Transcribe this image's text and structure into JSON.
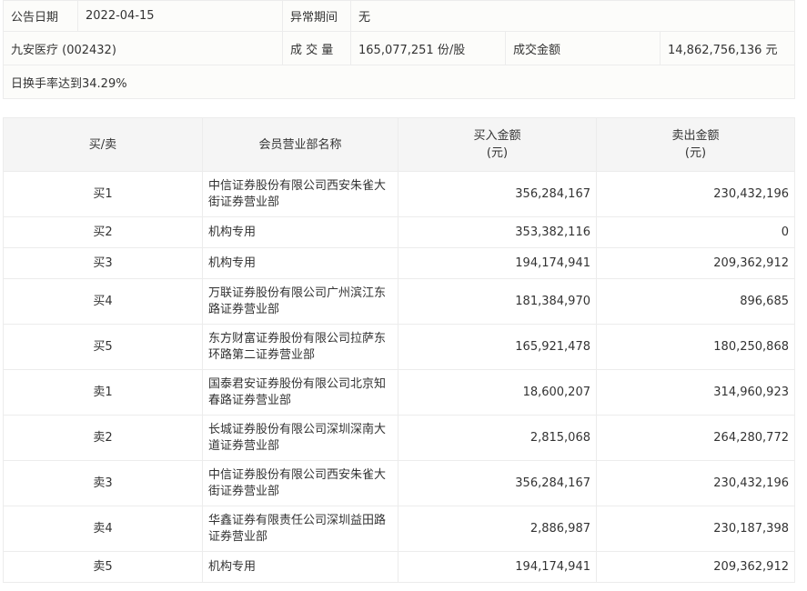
{
  "info": {
    "date_label": "公告日期",
    "date": "2022-04-15",
    "period_label": "异常期间",
    "period": "无",
    "stock": "九安医疗 (002432)",
    "volume_label": "成 交 量",
    "volume": "165,077,251 份/股",
    "amount_label": "成交金额",
    "amount": "14,862,756,136 元",
    "reason": "日换手率达到34.29%"
  },
  "table": {
    "headers": [
      "买/卖",
      "会员营业部名称",
      "买入金额\n(元)",
      "卖出金额\n(元)"
    ],
    "rows": [
      {
        "side": "买1",
        "name": "中信证券股份有限公司西安朱雀大街证券营业部",
        "buy": "356,284,167",
        "sell": "230,432,196"
      },
      {
        "side": "买2",
        "name": "机构专用",
        "buy": "353,382,116",
        "sell": "0"
      },
      {
        "side": "买3",
        "name": "机构专用",
        "buy": "194,174,941",
        "sell": "209,362,912"
      },
      {
        "side": "买4",
        "name": "万联证券股份有限公司广州滨江东路证券营业部",
        "buy": "181,384,970",
        "sell": "896,685"
      },
      {
        "side": "买5",
        "name": "东方财富证券股份有限公司拉萨东环路第二证券营业部",
        "buy": "165,921,478",
        "sell": "180,250,868"
      },
      {
        "side": "卖1",
        "name": "国泰君安证券股份有限公司北京知春路证券营业部",
        "buy": "18,600,207",
        "sell": "314,960,923"
      },
      {
        "side": "卖2",
        "name": "长城证券股份有限公司深圳深南大道证券营业部",
        "buy": "2,815,068",
        "sell": "264,280,772"
      },
      {
        "side": "卖3",
        "name": "中信证券股份有限公司西安朱雀大街证券营业部",
        "buy": "356,284,167",
        "sell": "230,432,196"
      },
      {
        "side": "卖4",
        "name": "华鑫证券有限责任公司深圳益田路证券营业部",
        "buy": "2,886,987",
        "sell": "230,187,398"
      },
      {
        "side": "卖5",
        "name": "机构专用",
        "buy": "194,174,941",
        "sell": "209,362,912"
      }
    ]
  }
}
